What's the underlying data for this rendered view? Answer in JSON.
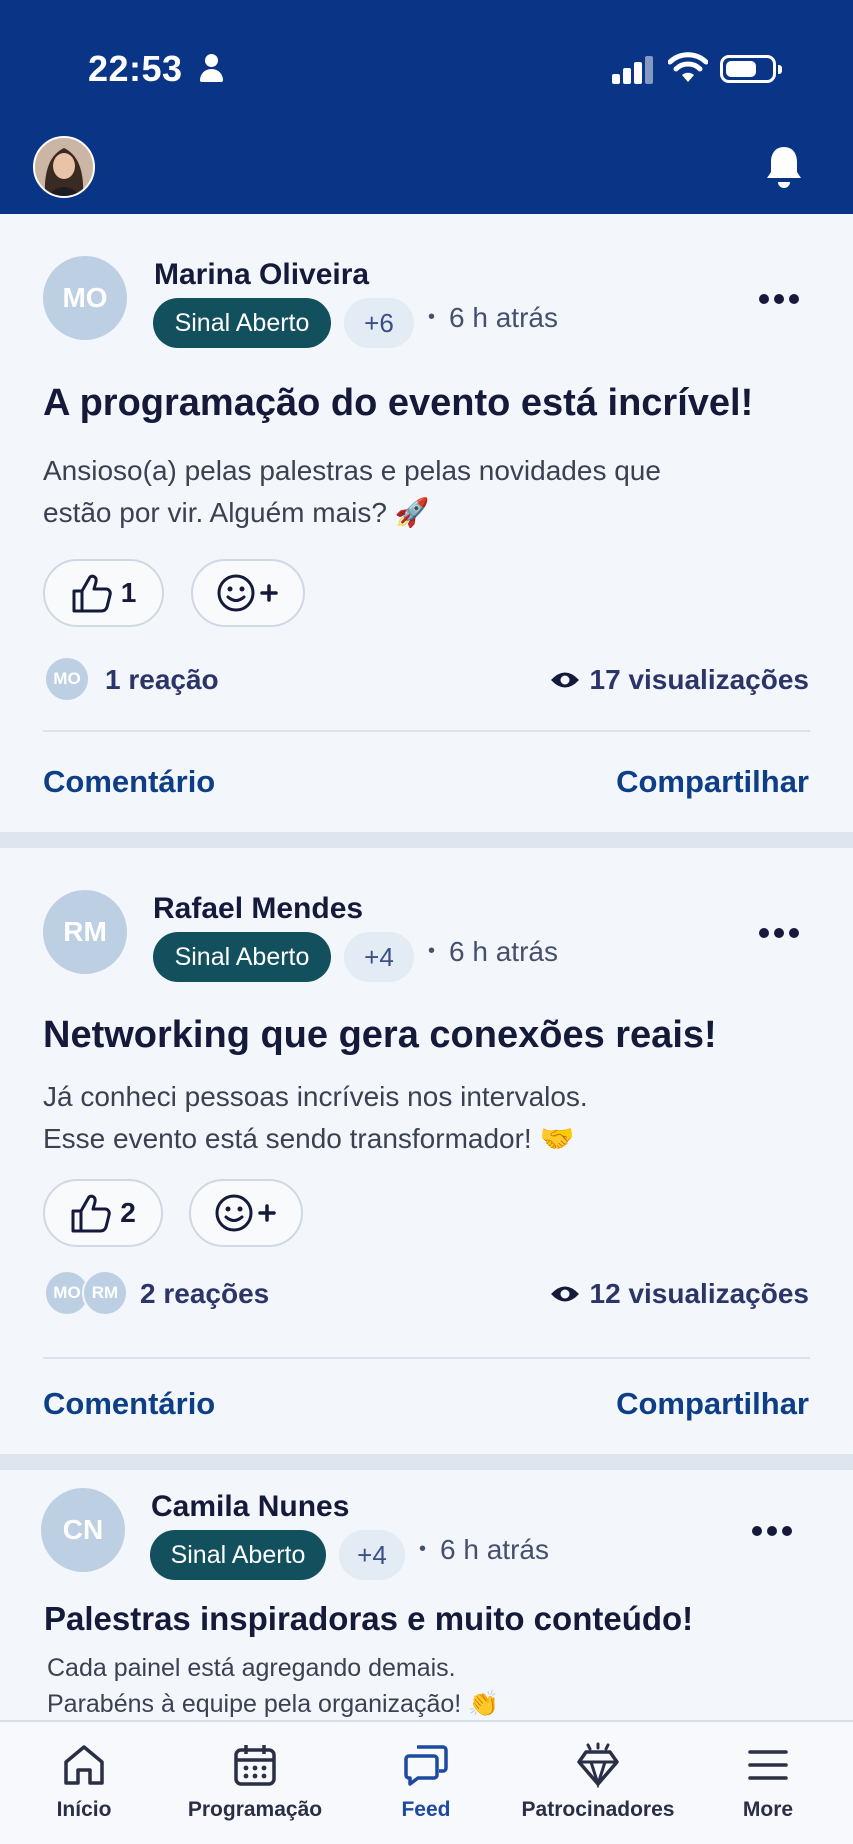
{
  "status_bar": {
    "time": "22:53"
  },
  "header": {
    "avatar_icon": "user-photo",
    "bell_icon": "bell-icon"
  },
  "posts": [
    {
      "initials": "MO",
      "author": "Marina Oliveira",
      "tag": "Sinal Aberto",
      "extra_tags": "+6",
      "time_ago": "6 h atrás",
      "title": "A programação do evento está incrível!",
      "body_line1": "Ansioso(a) pelas palestras e pelas novidades que",
      "body_line2": "estão por vir. Alguém mais? 🚀",
      "like_count": "1",
      "reactor_initials": [
        "MO"
      ],
      "reactions_label": "1 reação",
      "views_label": "17 visualizações",
      "comment_label": "Comentário",
      "share_label": "Compartilhar"
    },
    {
      "initials": "RM",
      "author": "Rafael Mendes",
      "tag": "Sinal Aberto",
      "extra_tags": "+4",
      "time_ago": "6 h atrás",
      "title": "Networking que gera conexões reais!",
      "body_line1": "Já conheci pessoas incríveis nos intervalos.",
      "body_line2": "Esse evento está sendo transformador! 🤝",
      "like_count": "2",
      "reactor_initials": [
        "MO",
        "RM"
      ],
      "reactions_label": "2 reações",
      "views_label": "12 visualizações",
      "comment_label": "Comentário",
      "share_label": "Compartilhar"
    },
    {
      "initials": "CN",
      "author": "Camila Nunes",
      "tag": "Sinal Aberto",
      "extra_tags": "+4",
      "time_ago": "6 h atrás",
      "title": "Palestras inspiradoras e muito conteúdo!",
      "body_line1": "Cada painel está agregando demais.",
      "body_line2": "Parabéns à equipe pela organização! 👏"
    }
  ],
  "tabs": [
    {
      "label": "Início",
      "icon": "home-icon"
    },
    {
      "label": "Programação",
      "icon": "calendar-icon"
    },
    {
      "label": "Feed",
      "icon": "chat-bubbles-icon",
      "active": true
    },
    {
      "label": "Patrocinadores",
      "icon": "diamond-icon"
    },
    {
      "label": "More",
      "icon": "menu-icon"
    }
  ],
  "colors": {
    "header_bg": "#0a3587",
    "tag_bg": "#12505e",
    "action_text": "#0e3f86",
    "active_tab": "#1d4aa0"
  }
}
